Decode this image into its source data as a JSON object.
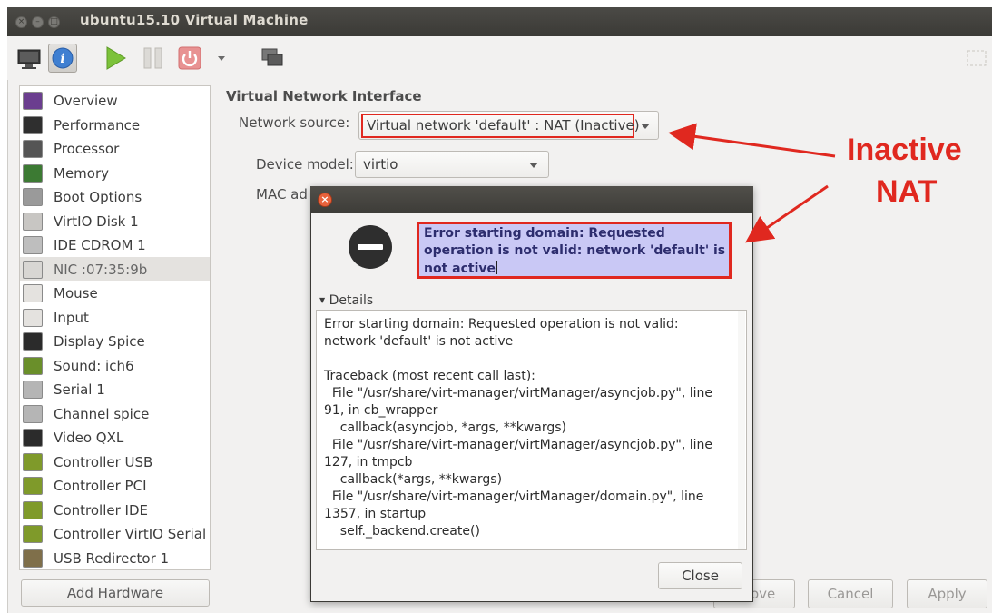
{
  "window": {
    "title": "ubuntu15.10 Virtual Machine"
  },
  "toolbar": {
    "icons": [
      "monitor-icon",
      "info-icon",
      "play-icon",
      "pause-icon",
      "power-icon",
      "dropdown-arrow-icon",
      "screenshot-icon",
      "fullscreen-icon"
    ]
  },
  "sidebar": {
    "items": [
      {
        "label": "Overview",
        "icon": "overview-icon"
      },
      {
        "label": "Performance",
        "icon": "performance-icon"
      },
      {
        "label": "Processor",
        "icon": "cpu-icon"
      },
      {
        "label": "Memory",
        "icon": "memory-icon"
      },
      {
        "label": "Boot Options",
        "icon": "gears-icon"
      },
      {
        "label": "VirtIO Disk 1",
        "icon": "disk-icon"
      },
      {
        "label": "IDE CDROM 1",
        "icon": "cdrom-icon"
      },
      {
        "label": "NIC :07:35:9b",
        "icon": "nic-icon"
      },
      {
        "label": "Mouse",
        "icon": "mouse-icon"
      },
      {
        "label": "Input",
        "icon": "tablet-icon"
      },
      {
        "label": "Display Spice",
        "icon": "display-icon"
      },
      {
        "label": "Sound: ich6",
        "icon": "sound-card-icon"
      },
      {
        "label": "Serial 1",
        "icon": "serial-icon"
      },
      {
        "label": "Channel spice",
        "icon": "channel-icon"
      },
      {
        "label": "Video QXL",
        "icon": "video-icon"
      },
      {
        "label": "Controller USB",
        "icon": "controller-icon"
      },
      {
        "label": "Controller PCI",
        "icon": "controller-icon"
      },
      {
        "label": "Controller IDE",
        "icon": "controller-icon"
      },
      {
        "label": "Controller VirtIO Serial",
        "icon": "controller-icon"
      },
      {
        "label": "USB Redirector 1",
        "icon": "usb-icon"
      }
    ],
    "selected_index": 7,
    "add_hardware": "Add Hardware"
  },
  "details": {
    "section_title": "Virtual Network Interface",
    "network_source_label": "Network source:",
    "network_source_value": "Virtual network 'default' : NAT (Inactive)",
    "device_model_label": "Device model:",
    "device_model_value": "virtio",
    "mac_label_partial": "MAC ad"
  },
  "buttons": {
    "remove_partial": "ove",
    "cancel": "Cancel",
    "apply": "Apply"
  },
  "dialog": {
    "error_lines": [
      "Error starting domain: Requested",
      "operation is not valid: network 'default' is",
      "not active"
    ],
    "details_label": "Details",
    "details_lines": [
      "Error starting domain: Requested operation is not valid:",
      "network 'default' is not active",
      "",
      "Traceback (most recent call last):",
      "  File \"/usr/share/virt-manager/virtManager/asyncjob.py\", line",
      "91, in cb_wrapper",
      "    callback(asyncjob, *args, **kwargs)",
      "  File \"/usr/share/virt-manager/virtManager/asyncjob.py\", line",
      "127, in tmpcb",
      "    callback(*args, **kwargs)",
      "  File \"/usr/share/virt-manager/virtManager/domain.py\", line",
      "1357, in startup",
      "    self._backend.create()"
    ],
    "close_label": "Close"
  },
  "annotation": {
    "line1": "Inactive",
    "line2": "NAT",
    "color": "#e0281f"
  },
  "colors": {
    "titlebar": "#3b3a36",
    "window_bg": "#f2f1f0",
    "highlight_box": "#c9c8f5",
    "annotation_red": "#e0281f"
  }
}
